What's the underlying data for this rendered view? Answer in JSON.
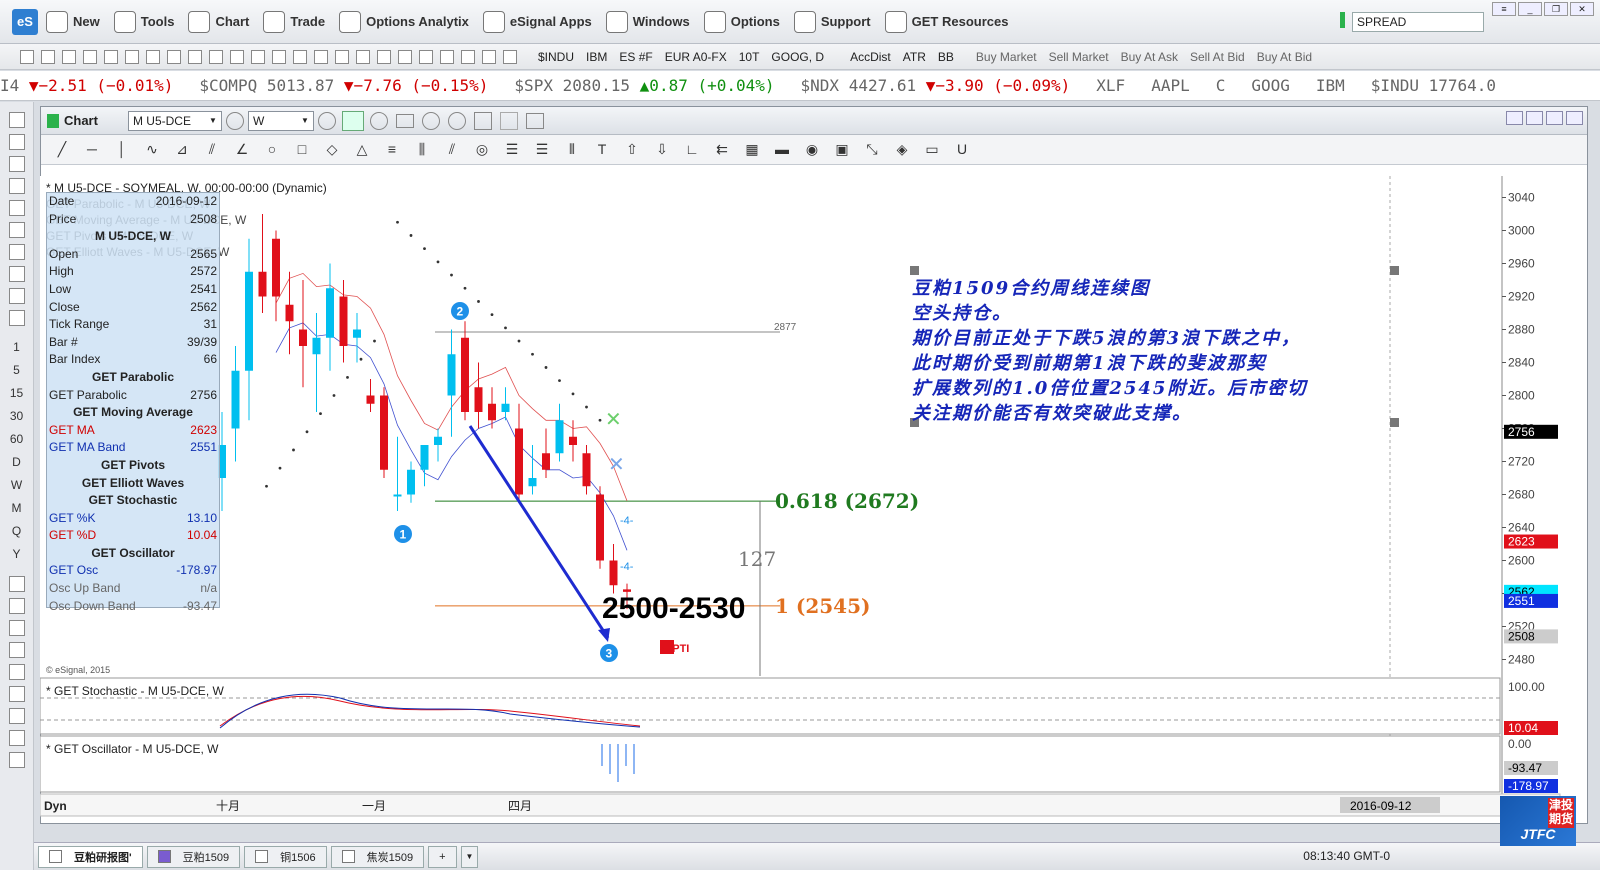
{
  "menubar": {
    "logo": "eS",
    "items": [
      {
        "label": "New",
        "icon": "new-chart-icon"
      },
      {
        "label": "Tools",
        "icon": "tools-icon"
      },
      {
        "label": "Chart",
        "icon": "chart-icon"
      },
      {
        "label": "Trade",
        "icon": "trade-icon"
      },
      {
        "label": "Options Analytix",
        "icon": "options-analytix-icon"
      },
      {
        "label": "eSignal Apps",
        "icon": "esignal-apps-icon"
      },
      {
        "label": "Windows",
        "icon": "windows-icon"
      },
      {
        "label": "Options",
        "icon": "gear-icon"
      },
      {
        "label": "Support",
        "icon": "help-icon"
      },
      {
        "label": "GET Resources",
        "icon": "get-icon"
      }
    ],
    "search_value": "SPREAD"
  },
  "toolbar2": {
    "symbols": [
      "$INDU",
      "IBM",
      "ES #F",
      "EUR A0-FX",
      "10T",
      "GOOG, D"
    ],
    "studies": [
      "AccDist",
      "ATR",
      "BB"
    ],
    "trade": [
      "Buy Market",
      "Sell Market",
      "Buy At Ask",
      "Sell At Bid",
      "Buy At Bid"
    ]
  },
  "ticker": [
    {
      "sym": "I4",
      "price": "",
      "chg": "▼−2.51 (−0.01%)",
      "dir": "down"
    },
    {
      "sym": "$COMPQ",
      "price": "5013.87",
      "chg": "▼−7.76 (−0.15%)",
      "dir": "down"
    },
    {
      "sym": "$SPX",
      "price": "2080.15",
      "chg": "▲0.87 (+0.04%)",
      "dir": "up"
    },
    {
      "sym": "$NDX",
      "price": "4427.61",
      "chg": "▼−3.90 (−0.09%)",
      "dir": "down"
    },
    {
      "sym": "XLF",
      "price": "",
      "chg": "",
      "dir": ""
    },
    {
      "sym": "AAPL",
      "price": "",
      "chg": "",
      "dir": ""
    },
    {
      "sym": "C",
      "price": "",
      "chg": "",
      "dir": ""
    },
    {
      "sym": "GOOG",
      "price": "",
      "chg": "",
      "dir": ""
    },
    {
      "sym": "IBM",
      "price": "",
      "chg": "",
      "dir": ""
    },
    {
      "sym": "$INDU",
      "price": "17764.0",
      "chg": "",
      "dir": ""
    }
  ],
  "left_intervals": [
    "1",
    "5",
    "15",
    "30",
    "60",
    "D",
    "W",
    "M",
    "Q",
    "Y"
  ],
  "chart_window": {
    "title": "Chart",
    "symbol": "M U5-DCE",
    "interval": "W"
  },
  "chart": {
    "header": "* M U5-DCE - SOYMEAL, W, 00:00-00:00 (Dynamic)",
    "study_labels": [
      "GET Parabolic - M U5-DCE, W",
      "GET Moving Average - M U5-DCE, W",
      "GET Pivots - M U5-DCE, W",
      "GET Elliott Waves - M U5-DCE, W"
    ],
    "copyright": "© eSignal, 2015",
    "fib_618": "0.618 (2672)",
    "fib_1": "1 (2545)",
    "level_2877": "2877",
    "measure": "127",
    "target": "2500-2530",
    "pti": "60PTI",
    "wave1": "1",
    "wave2": "2",
    "wave3": "3",
    "w4a": "-4-",
    "w4b": "-4-",
    "dyn": "Dyn",
    "date_label": "2016-09-12",
    "stoch_label": "* GET Stochastic - M U5-DCE, W",
    "osc_label": "* GET Oscillator - M U5-DCE, W"
  },
  "price_axis": {
    "ticks": [
      "3040",
      "3000",
      "2960",
      "2920",
      "2880",
      "2840",
      "2800",
      "2760",
      "2720",
      "2680",
      "2640",
      "2600",
      "2560",
      "2520",
      "2480"
    ],
    "badges": [
      {
        "text": "2756",
        "bg": "#000000",
        "fg": "#ffffff"
      },
      {
        "text": "2623",
        "bg": "#e0101a",
        "fg": "#ffffff"
      },
      {
        "text": "2562",
        "bg": "#00e5ff",
        "fg": "#000000"
      },
      {
        "text": "2551",
        "bg": "#1030e0",
        "fg": "#ffffff"
      },
      {
        "text": "2508",
        "bg": "#cccccc",
        "fg": "#000000"
      }
    ],
    "stoch_ticks": [
      "100.00"
    ],
    "stoch_badge": "10.04",
    "osc_ticks": [
      "0.00"
    ],
    "osc_badges": [
      "-93.47",
      "-178.97"
    ]
  },
  "time_axis": [
    "十月",
    "一月",
    "四月"
  ],
  "info_panel": {
    "rows": [
      {
        "k": "Date",
        "v": "2016-09-12",
        "c": ""
      },
      {
        "k": "Price",
        "v": "2508",
        "c": ""
      },
      {
        "k": "M U5-DCE, W",
        "v": "",
        "c": "hd"
      },
      {
        "k": "Open",
        "v": "2565",
        "c": ""
      },
      {
        "k": "High",
        "v": "2572",
        "c": ""
      },
      {
        "k": "Low",
        "v": "2541",
        "c": ""
      },
      {
        "k": "Close",
        "v": "2562",
        "c": ""
      },
      {
        "k": "Tick Range",
        "v": "31",
        "c": ""
      },
      {
        "k": "Bar #",
        "v": "39/39",
        "c": ""
      },
      {
        "k": "Bar Index",
        "v": "66",
        "c": ""
      },
      {
        "k": "GET Parabolic",
        "v": "",
        "c": "hd"
      },
      {
        "k": "GET Parabolic",
        "v": "2756",
        "c": ""
      },
      {
        "k": "GET Moving Average",
        "v": "",
        "c": "hd"
      },
      {
        "k": "GET MA",
        "v": "2623",
        "c": "red"
      },
      {
        "k": "GET MA Band",
        "v": "2551",
        "c": "blue"
      },
      {
        "k": "GET Pivots",
        "v": "",
        "c": "hd"
      },
      {
        "k": "GET Elliott Waves",
        "v": "",
        "c": "hd"
      },
      {
        "k": "GET Stochastic",
        "v": "",
        "c": "hd"
      },
      {
        "k": "GET %K",
        "v": "13.10",
        "c": "blue"
      },
      {
        "k": "GET %D",
        "v": "10.04",
        "c": "red"
      },
      {
        "k": "GET Oscillator",
        "v": "",
        "c": "hd"
      },
      {
        "k": "GET Osc",
        "v": "-178.97",
        "c": "blue"
      },
      {
        "k": "Osc Up Band",
        "v": "n/a",
        "c": "grey"
      },
      {
        "k": "Osc Down Band",
        "v": "-93.47",
        "c": "grey"
      }
    ]
  },
  "annotation": {
    "lines": [
      "豆粕1509合约周线连续图",
      "空头持仓。",
      "期价目前正处于下跌5浪的第3浪下跌之中，",
      "此时期价受到前期第1浪下跌的斐波那契",
      "扩展数列的1.0倍位置2545附近。后市密切",
      "关注期价能否有效突破此支撑。"
    ]
  },
  "taskbar": {
    "tabs": [
      {
        "label": "豆粕研报图'",
        "color": "#ffffff",
        "active": true
      },
      {
        "label": "豆粕1509",
        "color": "#7a5cd0",
        "active": false
      },
      {
        "label": "铜1506",
        "color": "#ffffff",
        "active": false
      },
      {
        "label": "焦炭1509",
        "color": "#ffffff",
        "active": false
      }
    ],
    "add": "+",
    "clock": "08:13:40 GMT-0"
  },
  "brand": {
    "text": "JTFC",
    "cn": "津投期货"
  },
  "chart_data": {
    "type": "candlestick",
    "symbol": "M U5-DCE",
    "interval": "W",
    "ylim": [
      2460,
      3060
    ],
    "candles": [
      {
        "o": 2700,
        "h": 2780,
        "l": 2660,
        "c": 2740
      },
      {
        "o": 2760,
        "h": 2860,
        "l": 2720,
        "c": 2830
      },
      {
        "o": 2830,
        "h": 2990,
        "l": 2770,
        "c": 2950
      },
      {
        "o": 2950,
        "h": 3020,
        "l": 2900,
        "c": 2920
      },
      {
        "o": 2990,
        "h": 3000,
        "l": 2890,
        "c": 2920
      },
      {
        "o": 2910,
        "h": 2950,
        "l": 2850,
        "c": 2890
      },
      {
        "o": 2880,
        "h": 2940,
        "l": 2810,
        "c": 2860
      },
      {
        "o": 2850,
        "h": 2900,
        "l": 2780,
        "c": 2870
      },
      {
        "o": 2870,
        "h": 2960,
        "l": 2830,
        "c": 2930
      },
      {
        "o": 2920,
        "h": 2940,
        "l": 2840,
        "c": 2860
      },
      {
        "o": 2870,
        "h": 2900,
        "l": 2840,
        "c": 2880
      },
      {
        "o": 2800,
        "h": 2820,
        "l": 2780,
        "c": 2790
      },
      {
        "o": 2800,
        "h": 2810,
        "l": 2700,
        "c": 2710
      },
      {
        "o": 2680,
        "h": 2750,
        "l": 2660,
        "c": 2680
      },
      {
        "o": 2680,
        "h": 2720,
        "l": 2670,
        "c": 2710
      },
      {
        "o": 2710,
        "h": 2740,
        "l": 2690,
        "c": 2740
      },
      {
        "o": 2740,
        "h": 2760,
        "l": 2720,
        "c": 2750
      },
      {
        "o": 2800,
        "h": 2880,
        "l": 2750,
        "c": 2850
      },
      {
        "o": 2870,
        "h": 2890,
        "l": 2770,
        "c": 2780
      },
      {
        "o": 2810,
        "h": 2840,
        "l": 2760,
        "c": 2780
      },
      {
        "o": 2790,
        "h": 2810,
        "l": 2760,
        "c": 2770
      },
      {
        "o": 2780,
        "h": 2810,
        "l": 2770,
        "c": 2790
      },
      {
        "o": 2760,
        "h": 2790,
        "l": 2670,
        "c": 2680
      },
      {
        "o": 2690,
        "h": 2740,
        "l": 2680,
        "c": 2700
      },
      {
        "o": 2730,
        "h": 2760,
        "l": 2700,
        "c": 2710
      },
      {
        "o": 2730,
        "h": 2790,
        "l": 2720,
        "c": 2770
      },
      {
        "o": 2750,
        "h": 2770,
        "l": 2720,
        "c": 2740
      },
      {
        "o": 2730,
        "h": 2740,
        "l": 2680,
        "c": 2690
      },
      {
        "o": 2680,
        "h": 2690,
        "l": 2590,
        "c": 2600
      },
      {
        "o": 2600,
        "h": 2620,
        "l": 2560,
        "c": 2570
      },
      {
        "o": 2565,
        "h": 2572,
        "l": 2541,
        "c": 2562
      }
    ],
    "levels": [
      {
        "value": 2877,
        "label": "2877"
      },
      {
        "value": 2672,
        "label": "0.618 (2672)"
      },
      {
        "value": 2545,
        "label": "1 (2545)"
      }
    ]
  }
}
